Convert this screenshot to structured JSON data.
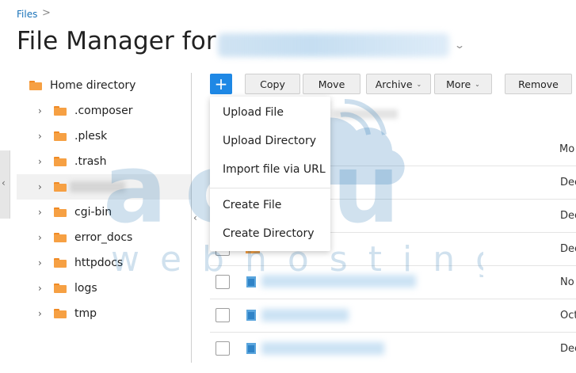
{
  "breadcrumb": {
    "link": "Files",
    "separator": ">"
  },
  "header": {
    "title": "File Manager for"
  },
  "tree": {
    "root": {
      "label": "Home directory"
    },
    "items": [
      {
        "label": ".composer"
      },
      {
        "label": ".plesk"
      },
      {
        "label": ".trash"
      },
      {
        "label": ""
      },
      {
        "label": "cgi-bin"
      },
      {
        "label": "error_docs"
      },
      {
        "label": "httpdocs"
      },
      {
        "label": "logs"
      },
      {
        "label": "tmp"
      }
    ]
  },
  "toolbar": {
    "add": "+",
    "copy": "Copy",
    "move": "Move",
    "archive": "Archive",
    "more": "More",
    "remove": "Remove"
  },
  "menu": {
    "upload_file": "Upload File",
    "upload_directory": "Upload Directory",
    "import_url": "Import file via URL",
    "create_file": "Create File",
    "create_directory": "Create Directory"
  },
  "table": {
    "modified_header": "Mo",
    "rows": [
      {
        "modified": "Dec"
      },
      {
        "modified": "Dec"
      },
      {
        "modified": "Dec",
        "name": "..."
      },
      {
        "modified": "No"
      },
      {
        "modified": "Oct"
      },
      {
        "modified": "Dec"
      }
    ]
  },
  "watermark": {
    "brand": "accu",
    "tagline": "webhosting"
  },
  "colors": {
    "accent": "#1e88e5",
    "folder": "#f6a043",
    "link": "#1a73b9"
  }
}
